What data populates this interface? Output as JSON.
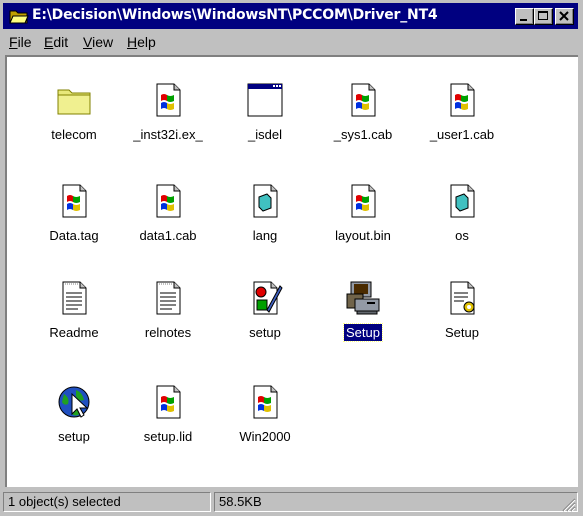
{
  "window": {
    "title": "E:\\Decision\\Windows\\WindowsNT\\PCCOM\\Driver_NT4",
    "controls": [
      "minimize-icon",
      "maximize-icon",
      "close-icon"
    ]
  },
  "menu": [
    {
      "key": "F",
      "rest": "ile"
    },
    {
      "key": "E",
      "rest": "dit"
    },
    {
      "key": "V",
      "rest": "iew"
    },
    {
      "key": "H",
      "rest": "elp"
    }
  ],
  "files": [
    {
      "label": "telecom",
      "icon": "folder-icon"
    },
    {
      "label": "_inst32i.ex_",
      "icon": "file-icon"
    },
    {
      "label": "_isdel",
      "icon": "application-window-icon"
    },
    {
      "label": "_sys1.cab",
      "icon": "file-icon"
    },
    {
      "label": "_user1.cab",
      "icon": "file-icon"
    },
    {
      "label": "Data.tag",
      "icon": "file-icon"
    },
    {
      "label": "data1.cab",
      "icon": "file-icon"
    },
    {
      "label": "lang",
      "icon": "document-icon"
    },
    {
      "label": "layout.bin",
      "icon": "file-icon"
    },
    {
      "label": "os",
      "icon": "document-icon"
    },
    {
      "label": "Readme",
      "icon": "text-document-icon"
    },
    {
      "label": "relnotes",
      "icon": "text-document-icon"
    },
    {
      "label": "setup",
      "icon": "setup-info-icon"
    },
    {
      "label": "Setup",
      "icon": "computer-setup-icon",
      "selected": true
    },
    {
      "label": "Setup",
      "icon": "config-settings-icon"
    },
    {
      "label": "setup",
      "icon": "globe-cursor-icon"
    },
    {
      "label": "setup.lid",
      "icon": "file-icon"
    },
    {
      "label": "Win2000",
      "icon": "file-icon"
    }
  ],
  "status": {
    "selection": "1 object(s) selected",
    "size": "58.5KB"
  }
}
